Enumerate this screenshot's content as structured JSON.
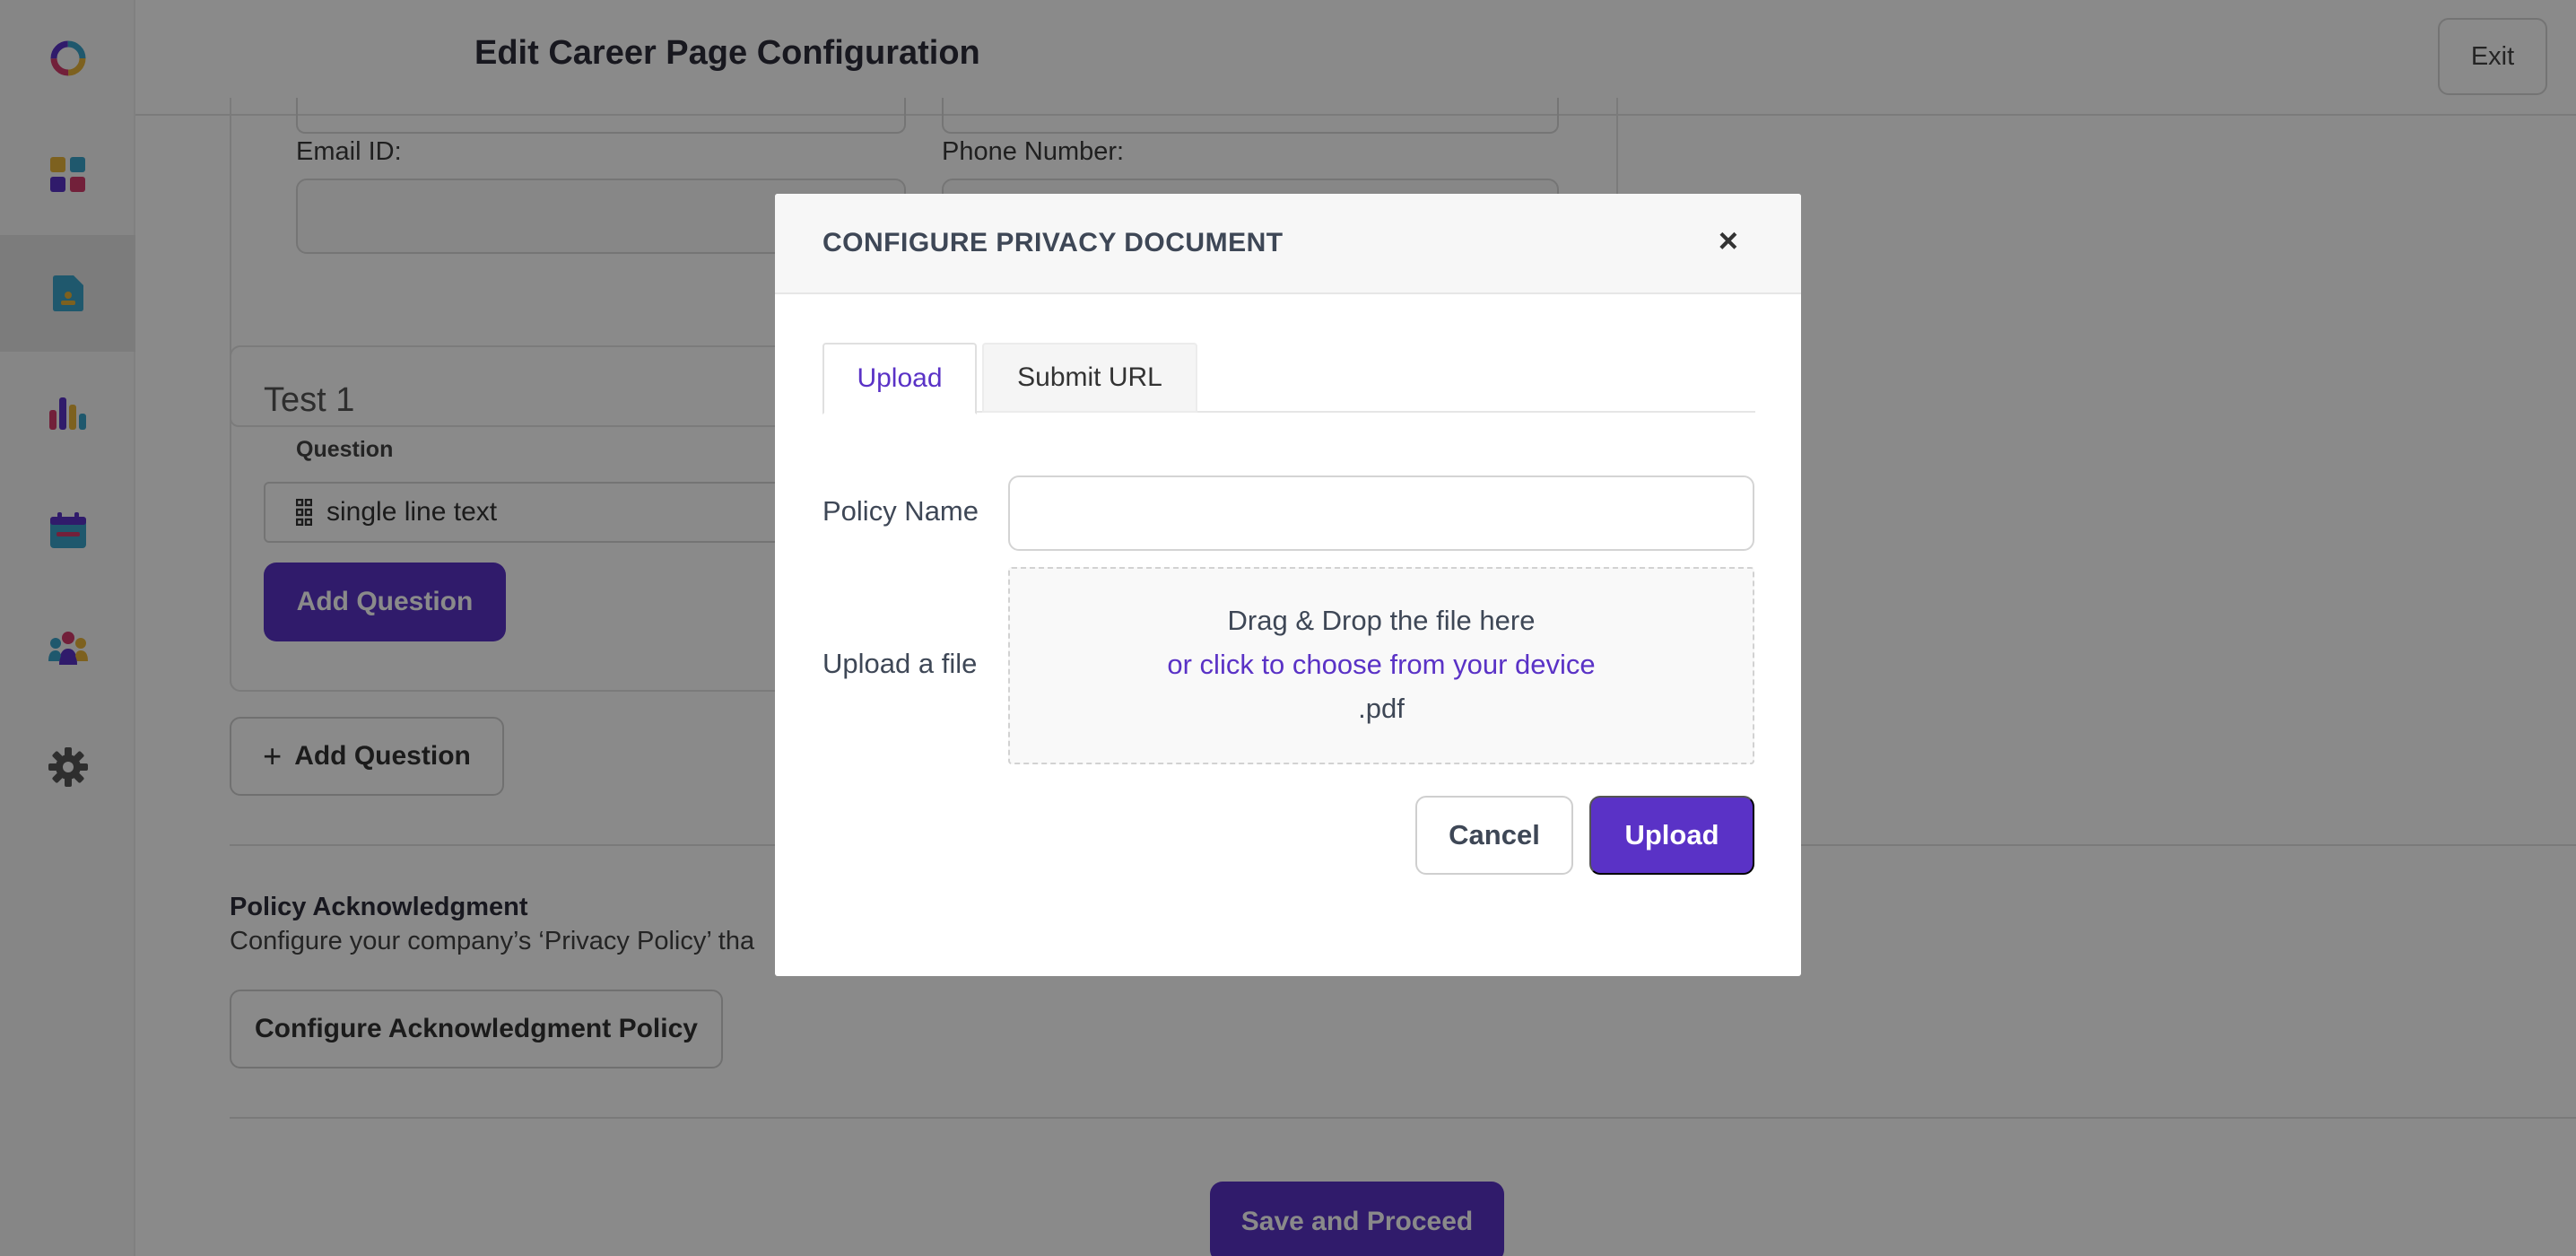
{
  "app": {
    "page_title": "Edit Career Page Configuration",
    "exit_label": "Exit"
  },
  "sidebar": {
    "items": [
      {
        "icon": "logo-ring-icon"
      },
      {
        "icon": "dashboard-grid-icon"
      },
      {
        "icon": "job-document-icon",
        "active": true
      },
      {
        "icon": "bar-chart-icon"
      },
      {
        "icon": "calendar-icon"
      },
      {
        "icon": "team-icon"
      },
      {
        "icon": "gear-icon"
      }
    ]
  },
  "form": {
    "email_label": "Email ID:",
    "phone_label": "Phone Number:"
  },
  "section": {
    "title": "Test 1",
    "question_label": "Question",
    "question_type": "single line text",
    "add_question_primary": "Add Question",
    "add_question_outline": "Add Question",
    "add_question_plus": "+"
  },
  "policy": {
    "title": "Policy Acknowledgment",
    "description": "Configure your company’s ‘Privacy Policy’ tha",
    "configure_button": "Configure Acknowledgment Policy"
  },
  "footer": {
    "save_label": "Save and Proceed"
  },
  "modal": {
    "title": "CONFIGURE PRIVACY DOCUMENT",
    "close_symbol": "×",
    "tabs": [
      {
        "label": "Upload",
        "active": true
      },
      {
        "label": "Submit URL",
        "active": false
      }
    ],
    "policy_name_label": "Policy Name",
    "policy_name_value": "",
    "upload_label": "Upload a file",
    "dropzone": {
      "line1": "Drag & Drop the file here",
      "line2": "or click to choose from your device",
      "line3": ".pdf"
    },
    "cancel_label": "Cancel",
    "upload_button_label": "Upload"
  },
  "colors": {
    "accent": "#5a32c6",
    "overlay": "rgba(0,0,0,0.46)"
  }
}
